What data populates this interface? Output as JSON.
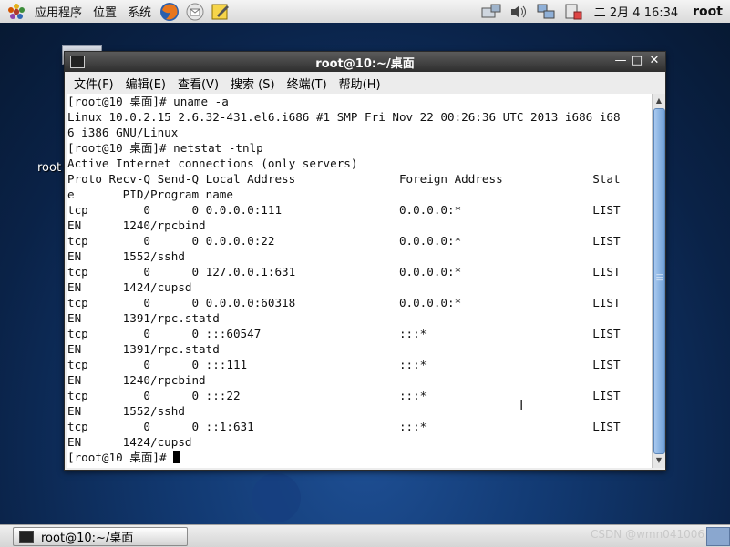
{
  "top_panel": {
    "menus": [
      "应用程序",
      "位置",
      "系统"
    ],
    "clock": "二 2月  4 16:34",
    "user": "root"
  },
  "desktop": {
    "icon_label": "root"
  },
  "window": {
    "title": "root@10:~/桌面",
    "menu": [
      "文件(F)",
      "编辑(E)",
      "查看(V)",
      "搜索 (S)",
      "终端(T)",
      "帮助(H)"
    ],
    "terminal_lines": [
      "[root@10 桌面]# uname -a",
      "Linux 10.0.2.15 2.6.32-431.el6.i686 #1 SMP Fri Nov 22 00:26:36 UTC 2013 i686 i68",
      "6 i386 GNU/Linux",
      "[root@10 桌面]# netstat -tnlp",
      "Active Internet connections (only servers)",
      "Proto Recv-Q Send-Q Local Address               Foreign Address             Stat",
      "e       PID/Program name",
      "tcp        0      0 0.0.0.0:111                 0.0.0.0:*                   LIST",
      "EN      1240/rpcbind",
      "tcp        0      0 0.0.0.0:22                  0.0.0.0:*                   LIST",
      "EN      1552/sshd",
      "tcp        0      0 127.0.0.1:631               0.0.0.0:*                   LIST",
      "EN      1424/cupsd",
      "tcp        0      0 0.0.0.0:60318               0.0.0.0:*                   LIST",
      "EN      1391/rpc.statd",
      "tcp        0      0 :::60547                    :::*                        LIST",
      "EN      1391/rpc.statd",
      "tcp        0      0 :::111                      :::*                        LIST",
      "EN      1240/rpcbind",
      "tcp        0      0 :::22                       :::*                        LIST",
      "EN      1552/sshd",
      "tcp        0      0 ::1:631                     :::*                        LIST",
      "EN      1424/cupsd"
    ],
    "prompt": "[root@10 桌面]# "
  },
  "bottom_panel": {
    "task_label": "root@10:~/桌面",
    "watermark": "CSDN @wmn041006"
  }
}
